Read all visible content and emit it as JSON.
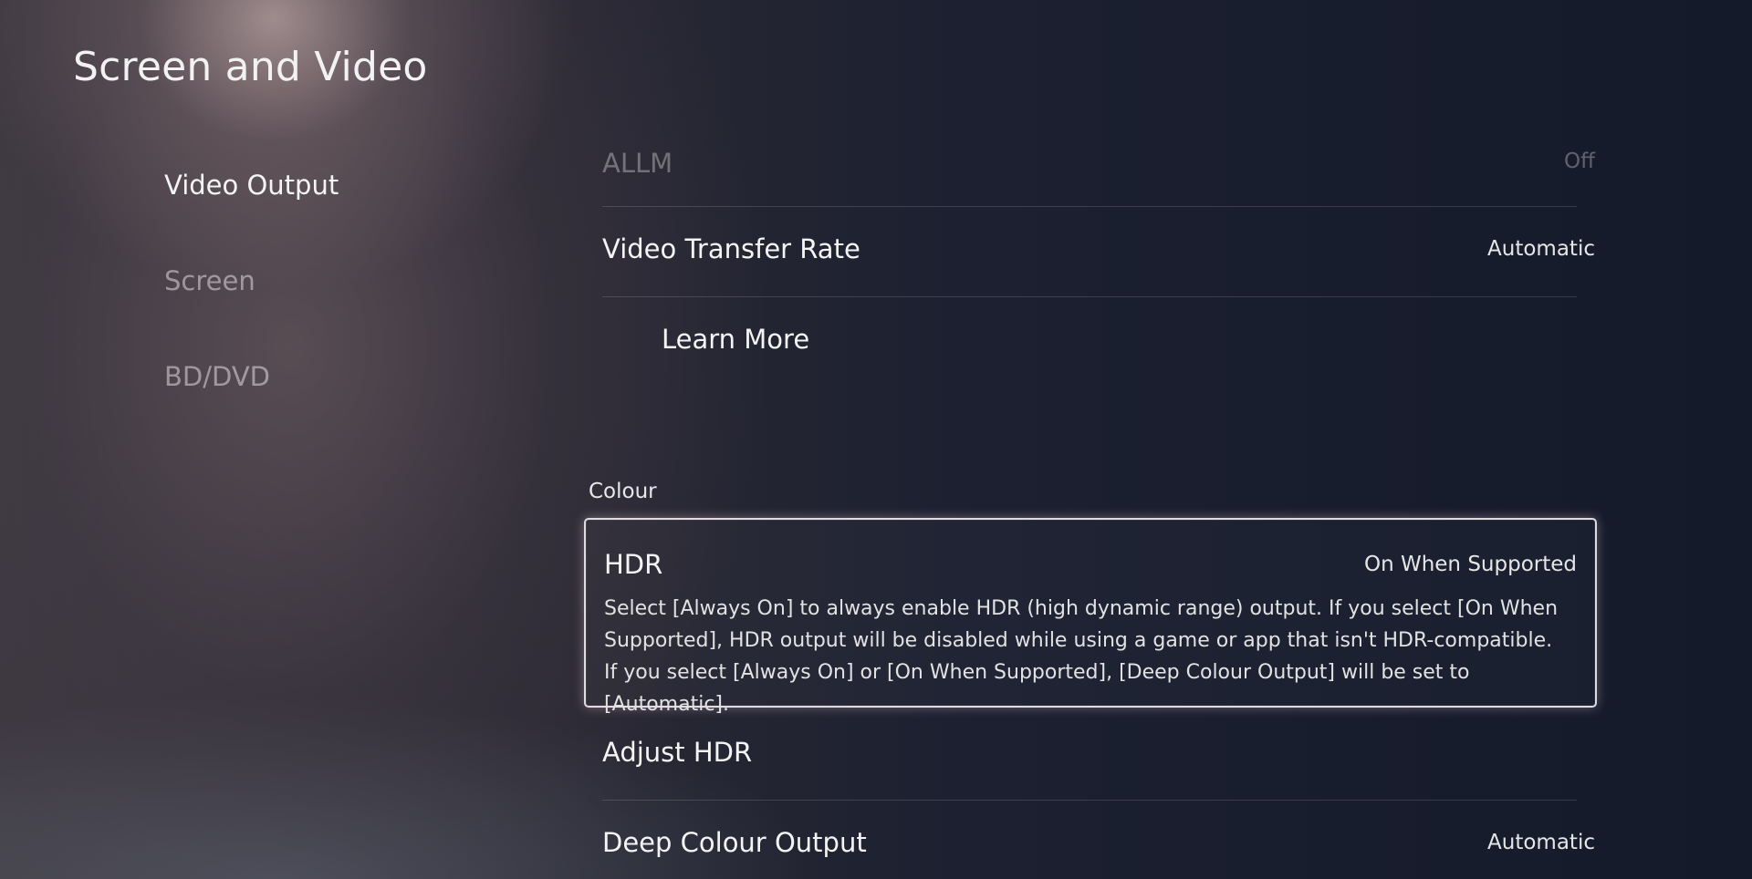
{
  "page": {
    "title": "Screen and Video"
  },
  "nav": {
    "items": [
      {
        "label": "Video Output",
        "active": true
      },
      {
        "label": "Screen",
        "active": false
      },
      {
        "label": "BD/DVD",
        "active": false
      }
    ]
  },
  "settings": {
    "allm": {
      "label": "ALLM",
      "value": "Off"
    },
    "video_transfer_rate": {
      "label": "Video Transfer Rate",
      "value": "Automatic"
    },
    "learn_more": {
      "label": "Learn More"
    },
    "colour_section": {
      "header": "Colour"
    },
    "hdr": {
      "label": "HDR",
      "value": "On When Supported",
      "description": "Select [Always On] to always enable HDR (high dynamic range) output. If you select [On When Supported], HDR output will be disabled while using a game or app that isn't HDR-compatible. If you select [Always On] or [On When Supported], [Deep Colour Output] will be set to [Automatic]."
    },
    "adjust_hdr": {
      "label": "Adjust HDR"
    },
    "deep_colour_output": {
      "label": "Deep Colour Output",
      "value": "Automatic"
    }
  },
  "colors": {
    "focus_border": "#f5f0f5",
    "text_primary": "#f4f4f4",
    "text_dim": "#8a8a8f"
  }
}
